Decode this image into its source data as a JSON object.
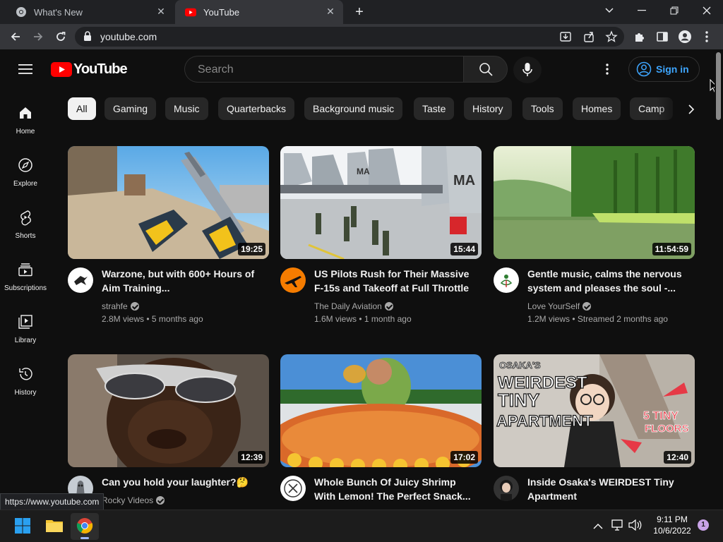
{
  "browser": {
    "tabs": [
      {
        "title": "What's New"
      },
      {
        "title": "YouTube"
      }
    ],
    "url": "youtube.com",
    "status_url": "https://www.youtube.com"
  },
  "masthead": {
    "logo_text": "YouTube",
    "search_placeholder": "Search",
    "signin_label": "Sign in"
  },
  "sidebar": {
    "items": [
      {
        "label": "Home",
        "icon": "home-icon"
      },
      {
        "label": "Explore",
        "icon": "compass-icon"
      },
      {
        "label": "Shorts",
        "icon": "shorts-icon"
      },
      {
        "label": "Subscriptions",
        "icon": "subscriptions-icon"
      },
      {
        "label": "Library",
        "icon": "library-icon"
      },
      {
        "label": "History",
        "icon": "history-icon"
      }
    ]
  },
  "chips": [
    "All",
    "Gaming",
    "Music",
    "Quarterbacks",
    "Background music",
    "Taste",
    "History",
    "Tools",
    "Homes",
    "Camp"
  ],
  "videos": [
    {
      "title": "Warzone, but with 600+ Hours of Aim Training...",
      "channel": "strahfe",
      "views": "2.8M views",
      "age": "5 months ago",
      "duration": "19:25"
    },
    {
      "title": "US Pilots Rush for Their Massive F-15s and Takeoff at Full Throttle",
      "channel": "The Daily Aviation",
      "views": "1.6M views",
      "age": "1 month ago",
      "duration": "15:44"
    },
    {
      "title": "Gentle music, calms the nervous system and pleases the soul -...",
      "channel": "Love YourSelf",
      "views": "1.2M views",
      "age": "Streamed 2 months ago",
      "duration": "11:54:59"
    },
    {
      "title": "Can you hold your laughter?🤔",
      "channel": "Rocky Videos",
      "duration": "12:39"
    },
    {
      "title": "Whole Bunch Of Juicy Shrimp With Lemon! The Perfect Snack...",
      "duration": "17:02"
    },
    {
      "title": "Inside Osaka's WEIRDEST Tiny Apartment",
      "duration": "12:40"
    }
  ],
  "thumbnail_text": {
    "fighter_jet_tail": "MA",
    "osaka_top": "OSAKA'S",
    "osaka_main_1": "WEIRDEST",
    "osaka_main_2": "TINY",
    "osaka_main_3": "APARTMENT",
    "osaka_side_1": "5 TINY",
    "osaka_side_2": "FLOORS"
  },
  "taskbar": {
    "time": "9:11 PM",
    "date": "10/6/2022",
    "notification_count": "1"
  },
  "colors": {
    "youtube_red": "#ff0000",
    "link_blue": "#3ea6ff",
    "background": "#0f0f0f"
  }
}
